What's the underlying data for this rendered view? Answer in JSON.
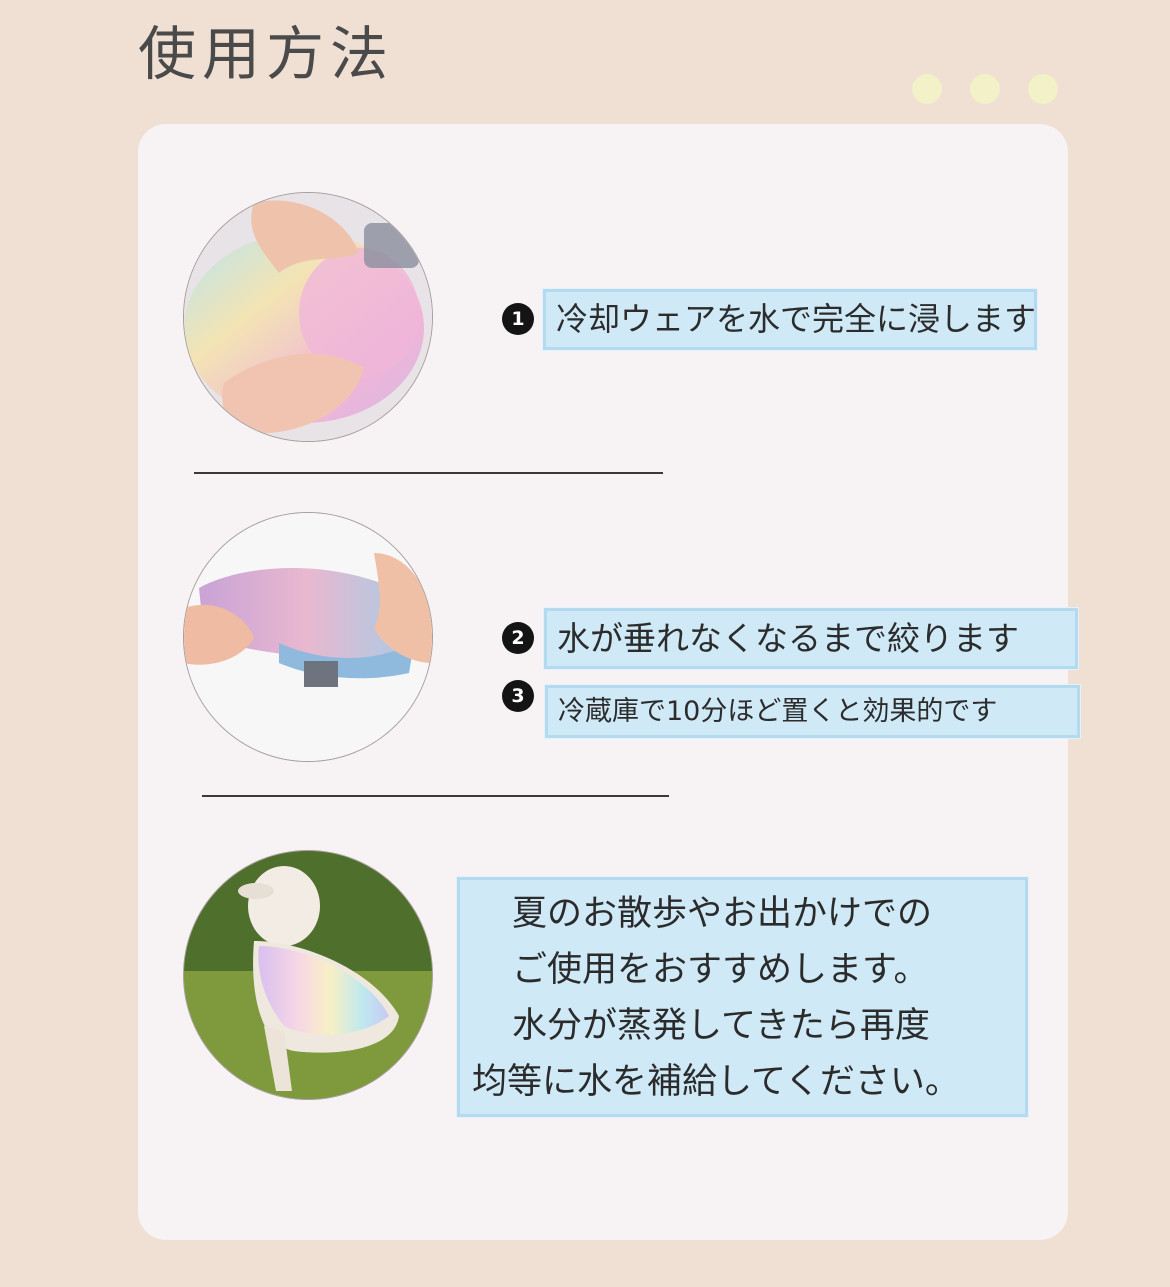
{
  "header": {
    "title": "使用方法"
  },
  "colors": {
    "background": "#f0dfd3",
    "card": "#f7f3f4",
    "tag_fill": "#cfe9f7",
    "tag_border": "#b4daf0",
    "dot": "#f2f1c8"
  },
  "steps": [
    {
      "number": "1",
      "text": "冷却ウェアを水で完全に浸します",
      "image": "hands-soaking-vest-photo"
    },
    {
      "number": "2",
      "text": "水が垂れなくなるまで絞ります",
      "image": "hands-wringing-vest-photo"
    },
    {
      "number": "3",
      "text": "冷蔵庫で10分ほど置くと効果的です"
    }
  ],
  "note": {
    "lines": [
      "夏のお散歩やお出かけでの",
      "ご使用をおすすめします。",
      "水分が蒸発してきたら再度",
      "均等に水を補給してください。"
    ],
    "image": "dog-wearing-cooling-vest-photo"
  }
}
